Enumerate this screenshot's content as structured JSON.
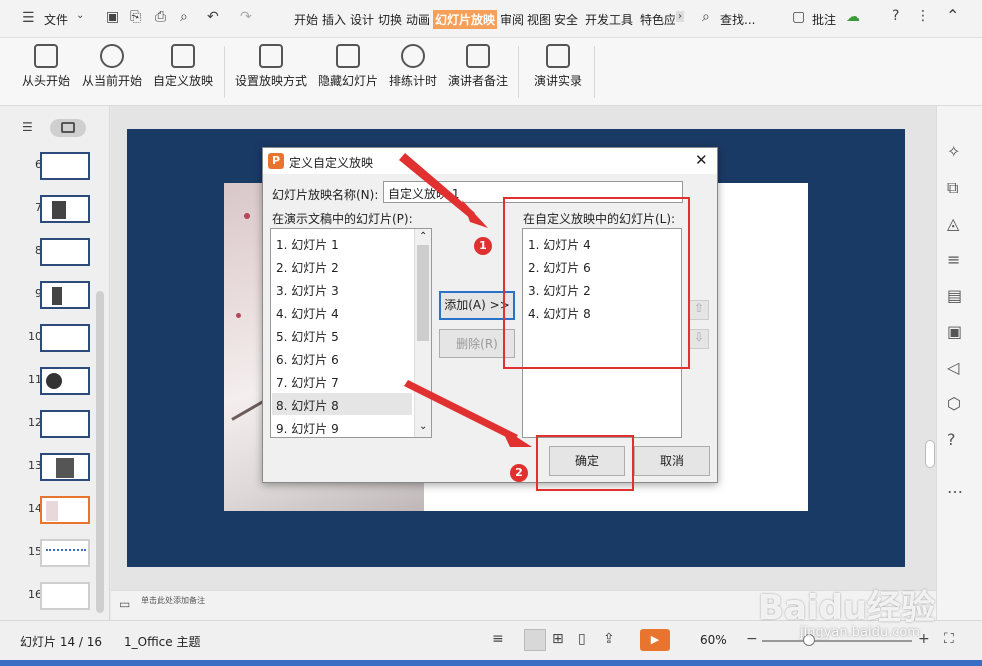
{
  "menubar": {
    "file_label": "文件",
    "tabs": [
      "开始",
      "插入",
      "设计",
      "切换",
      "动画",
      "幻灯片放映",
      "审阅",
      "视图",
      "安全",
      "开发工具",
      "特色应"
    ],
    "active_tab": "幻灯片放映",
    "search_label": "查找...",
    "comment_label": "批注"
  },
  "ribbon": {
    "buttons": [
      "从头开始",
      "从当前开始",
      "自定义放映",
      "设置放映方式",
      "隐藏幻灯片",
      "排练计时",
      "演讲者备注",
      "演讲实录"
    ]
  },
  "thumbnails": {
    "numbers": [
      "6",
      "7",
      "8",
      "9",
      "10",
      "11",
      "12",
      "13",
      "14",
      "15",
      "16"
    ],
    "selected": "14"
  },
  "notes": {
    "placeholder": "单击此处添加备注"
  },
  "dialog": {
    "title": "定义自定义放映",
    "name_label": "幻灯片放映名称(N):",
    "name_value": "自定义放映 1",
    "left_label": "在演示文稿中的幻灯片(P):",
    "right_label": "在自定义放映中的幻灯片(L):",
    "left_items": [
      "1. 幻灯片 1",
      "2. 幻灯片 2",
      "3. 幻灯片 3",
      "4. 幻灯片 4",
      "5. 幻灯片 5",
      "6. 幻灯片 6",
      "7. 幻灯片 7",
      "8. 幻灯片 8",
      "9. 幻灯片 9"
    ],
    "left_selected": "8. 幻灯片 8",
    "right_items": [
      "1. 幻灯片 4",
      "2. 幻灯片 6",
      "3. 幻灯片 2",
      "4. 幻灯片 8"
    ],
    "add_button": "添加(A) >>",
    "remove_button": "删除(R)",
    "ok_button": "确定",
    "cancel_button": "取消"
  },
  "annotations": {
    "marker1": "1",
    "marker2": "2"
  },
  "statusbar": {
    "slide_info": "幻灯片 14 / 16",
    "theme": "1_Office 主题",
    "zoom": "60%"
  },
  "watermark": {
    "text": "Baidu经验",
    "url": "jingyan.baidu.com"
  },
  "colors": {
    "accent": "#f5a05a",
    "slide_bg": "#1a3a66",
    "annotation_red": "#e03030"
  }
}
